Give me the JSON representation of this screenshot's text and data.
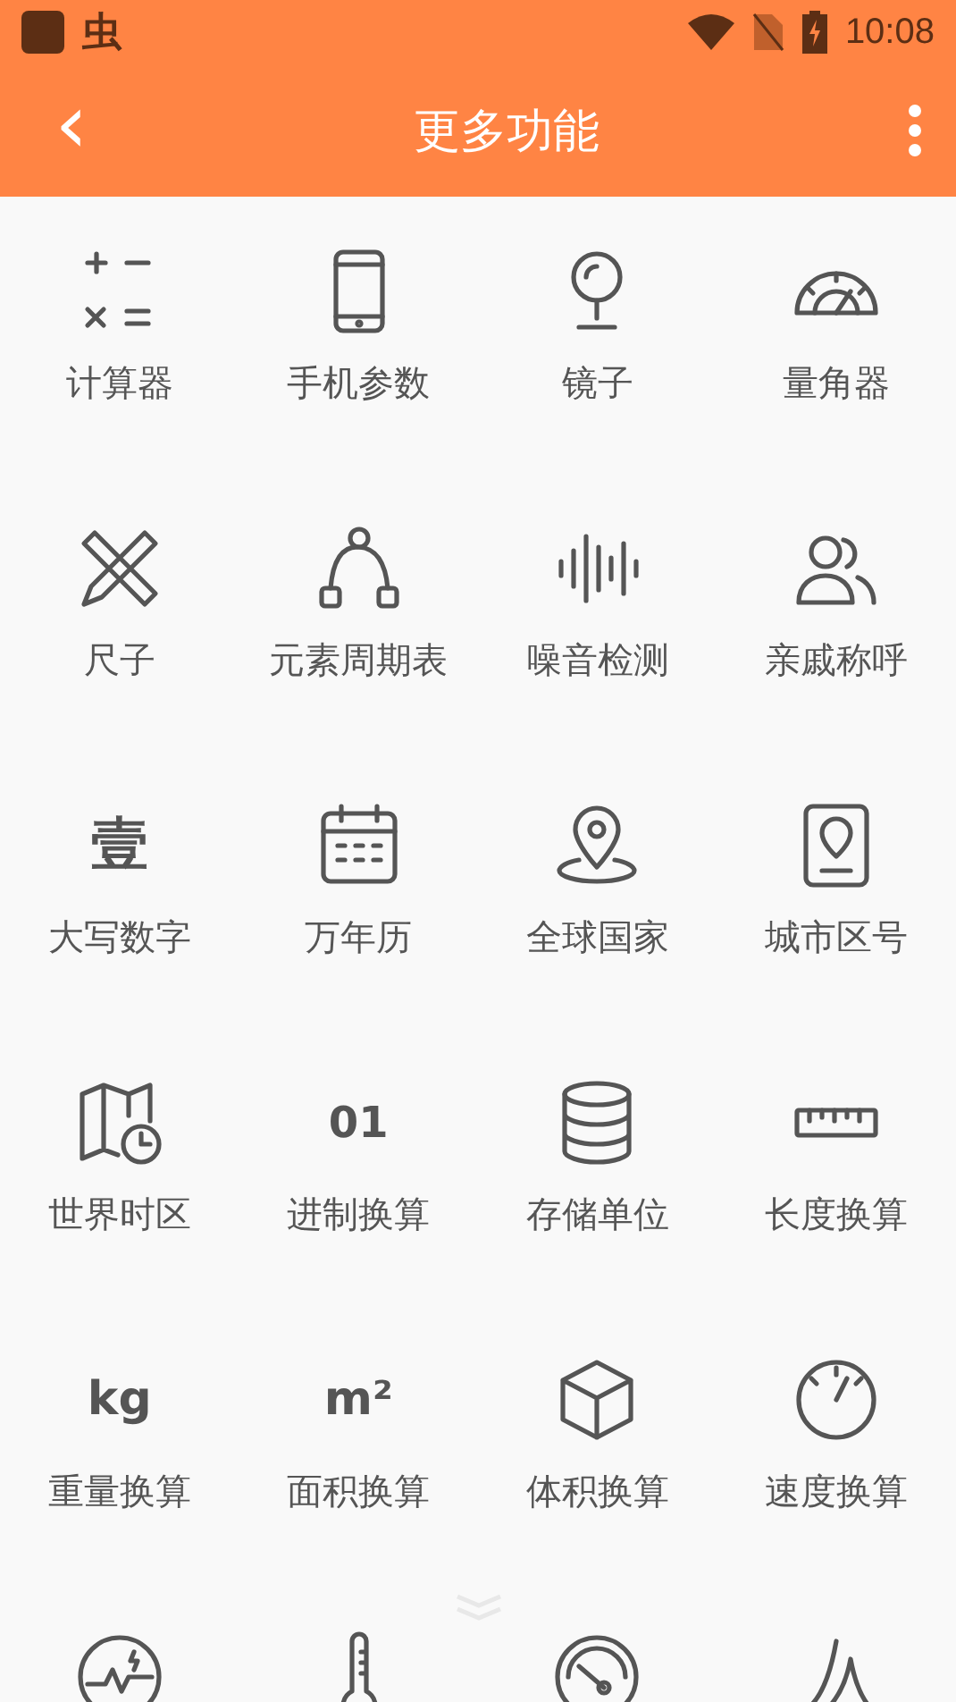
{
  "status_bar": {
    "time": "10:08",
    "app_glyph": "虫"
  },
  "app_bar": {
    "title": "更多功能",
    "back": "‹"
  },
  "tools": [
    {
      "label": "计算器"
    },
    {
      "label": "手机参数"
    },
    {
      "label": "镜子"
    },
    {
      "label": "量角器"
    },
    {
      "label": "尺子"
    },
    {
      "label": "元素周期表"
    },
    {
      "label": "噪音检测"
    },
    {
      "label": "亲戚称呼"
    },
    {
      "label": "大写数字",
      "glyph": "壹"
    },
    {
      "label": "万年历"
    },
    {
      "label": "全球国家"
    },
    {
      "label": "城市区号"
    },
    {
      "label": "世界时区"
    },
    {
      "label": "进制换算",
      "glyph": "01"
    },
    {
      "label": "存储单位"
    },
    {
      "label": "长度换算"
    },
    {
      "label": "重量换算",
      "glyph": "kg"
    },
    {
      "label": "面积换算",
      "glyph": "m²"
    },
    {
      "label": "体积换算"
    },
    {
      "label": "速度换算"
    },
    {
      "kind": "cut_off"
    },
    {
      "kind": "cut_off"
    },
    {
      "kind": "cut_off"
    },
    {
      "kind": "cut_off"
    }
  ]
}
